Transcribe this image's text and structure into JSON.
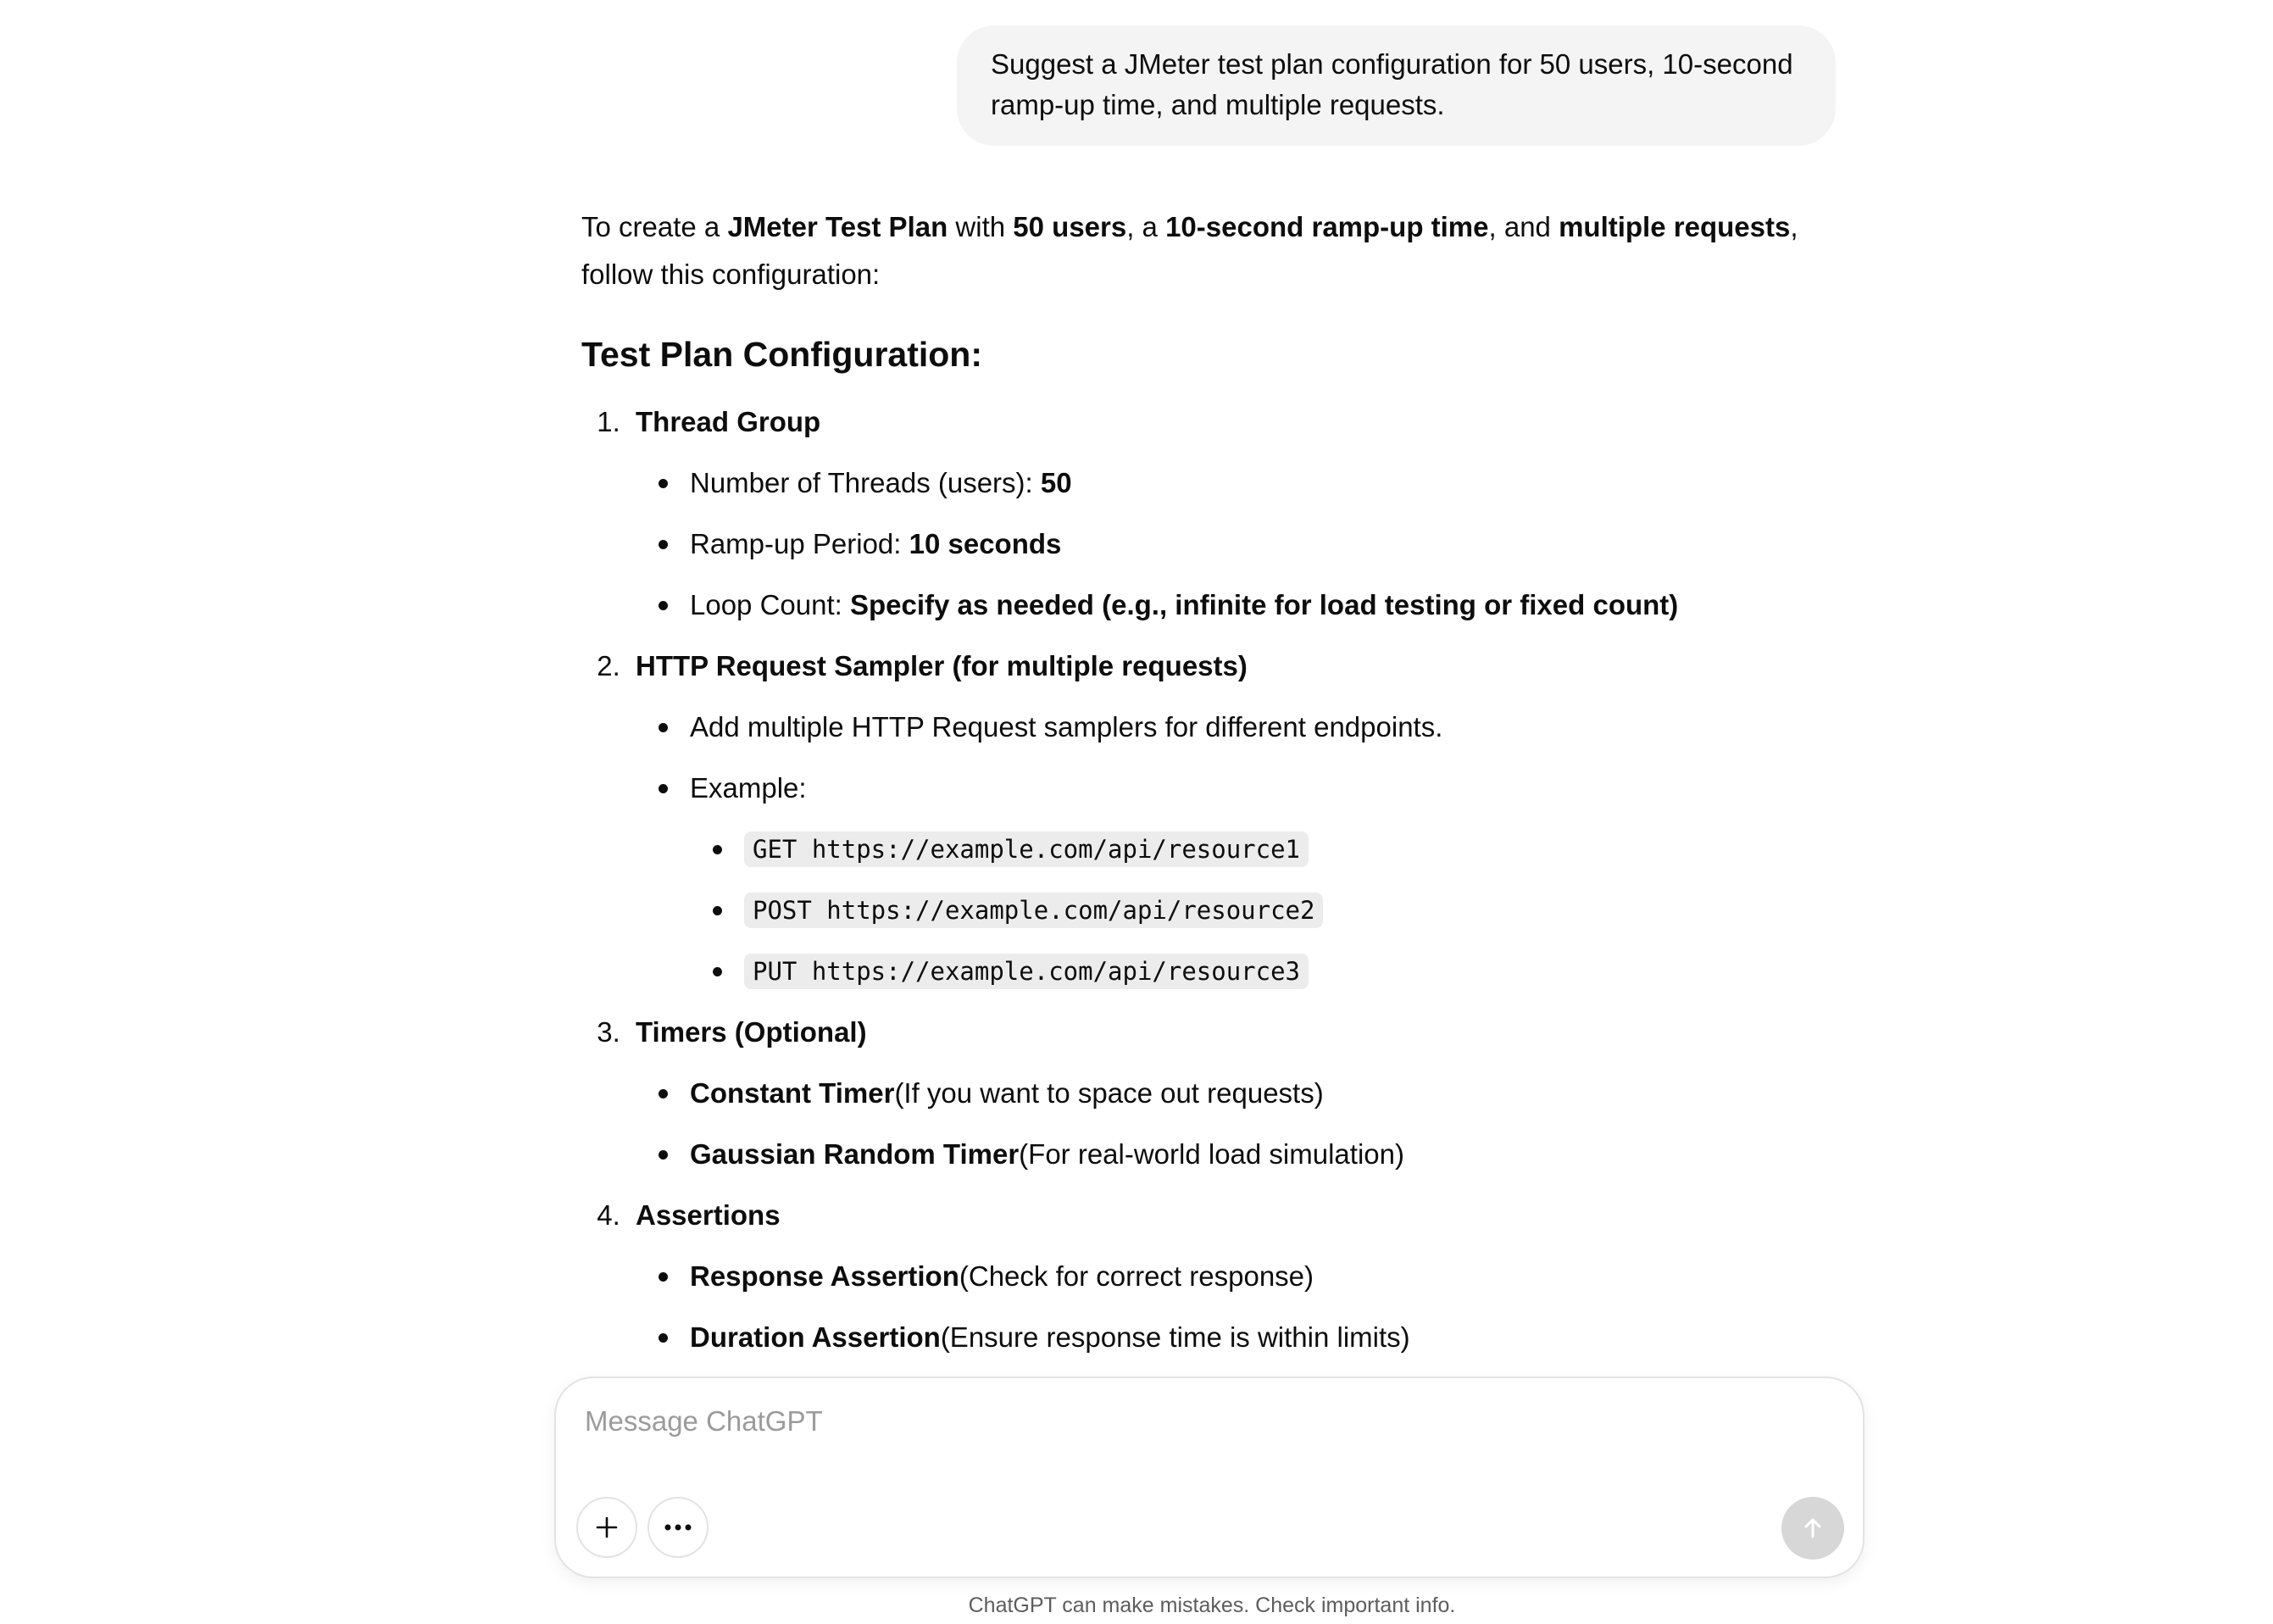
{
  "user_message": "Suggest a JMeter test plan configuration for 50 users, 10-second ramp-up time, and multiple requests.",
  "intro": {
    "t1": "To create a ",
    "b1": "JMeter Test Plan",
    "t2": " with ",
    "b2": "50 users",
    "t3": ", a ",
    "b3": "10-second ramp-up time",
    "t4": ", and ",
    "b4": "multiple requests",
    "t5": ", follow this configuration:"
  },
  "section_title": "Test Plan Configuration:",
  "steps": [
    {
      "num": "1.",
      "title": "Thread Group",
      "bullets": [
        {
          "label": "Number of Threads (users): ",
          "value": "50"
        },
        {
          "label": "Ramp-up Period: ",
          "value": "10 seconds"
        },
        {
          "label": "Loop Count: ",
          "value": "Specify as needed (e.g., infinite for load testing or fixed count)"
        }
      ]
    },
    {
      "num": "2.",
      "title": "HTTP Request Sampler (for multiple requests)",
      "bullets": [
        {
          "text": "Add multiple HTTP Request samplers for different endpoints."
        },
        {
          "text": "Example:"
        }
      ],
      "examples": [
        "GET https://example.com/api/resource1",
        "POST https://example.com/api/resource2",
        "PUT https://example.com/api/resource3"
      ]
    },
    {
      "num": "3.",
      "title": "Timers (Optional)",
      "bullets": [
        {
          "bold": "Constant Timer",
          "text": " (If you want to space out requests)"
        },
        {
          "bold": "Gaussian Random Timer",
          "text": " (For real-world load simulation)"
        }
      ]
    },
    {
      "num": "4.",
      "title": "Assertions",
      "bullets": [
        {
          "bold": "Response Assertion",
          "text": " (Check for correct response)"
        },
        {
          "bold": "Duration Assertion",
          "text": " (Ensure response time is within limits)"
        }
      ]
    }
  ],
  "composer": {
    "placeholder": "Message ChatGPT",
    "value": ""
  },
  "icons": {
    "attach": "plus-icon",
    "tools": "more-horizontal-icon",
    "send": "arrow-up-icon"
  },
  "disclaimer": "ChatGPT can make mistakes. Check important info."
}
